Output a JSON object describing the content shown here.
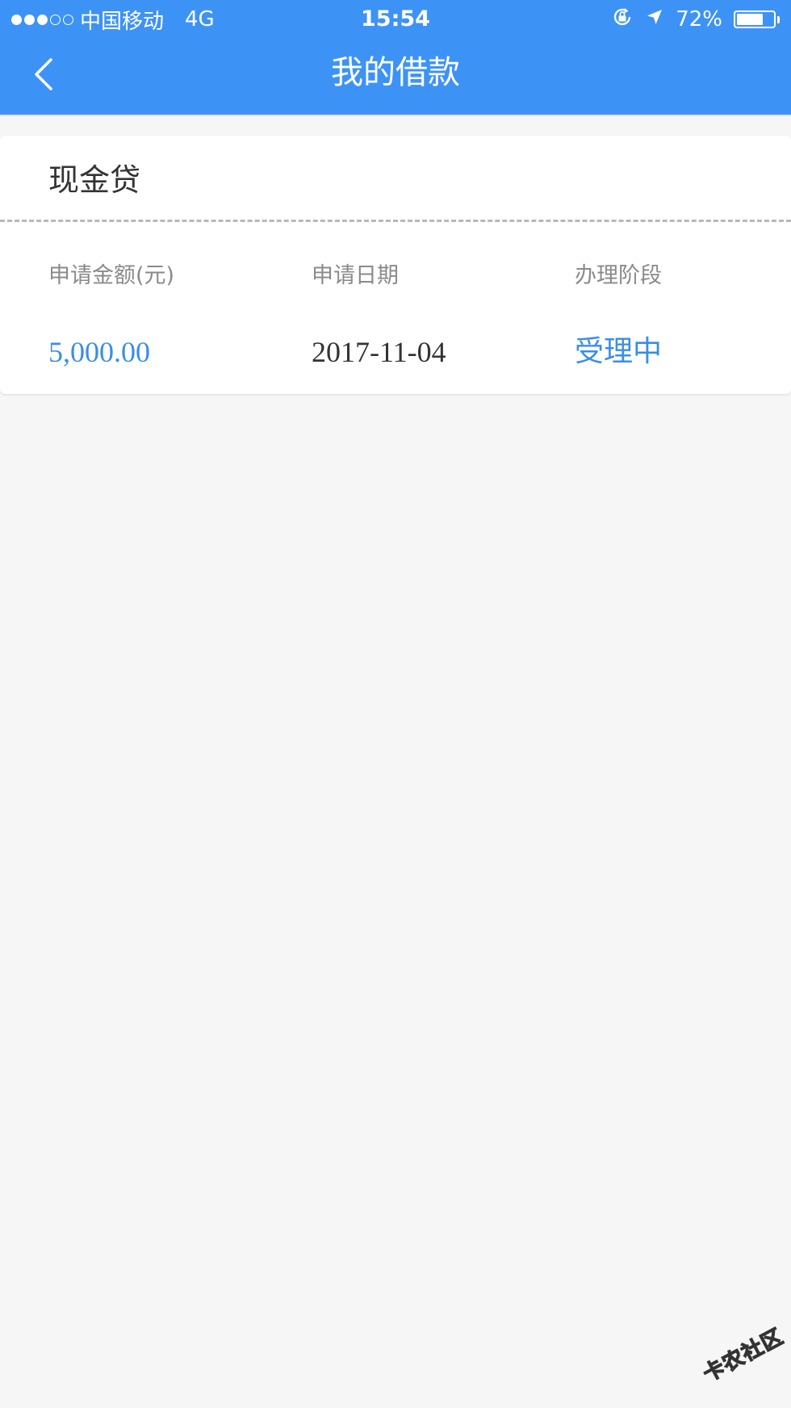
{
  "status_bar": {
    "carrier": "中国移动",
    "network": "4G",
    "time": "15:54",
    "battery_percent": "72%",
    "battery_level": 0.72,
    "signal_strength": 3,
    "signal_max": 5,
    "icons": [
      "rotation-lock-icon",
      "location-arrow-icon",
      "battery-icon"
    ]
  },
  "nav": {
    "title": "我的借款",
    "back_icon": "chevron-left-icon"
  },
  "loan_card": {
    "title": "现金贷",
    "columns": [
      {
        "label": "申请金额(元)",
        "value": "5,000.00"
      },
      {
        "label": "申请日期",
        "value": "2017-11-04"
      },
      {
        "label": "办理阶段",
        "value": "受理中"
      }
    ]
  },
  "watermark": {
    "text": "卡农社区"
  },
  "colors": {
    "header": "#3d93f5",
    "accent": "#3a8ee6",
    "background": "#f6f6f6"
  }
}
